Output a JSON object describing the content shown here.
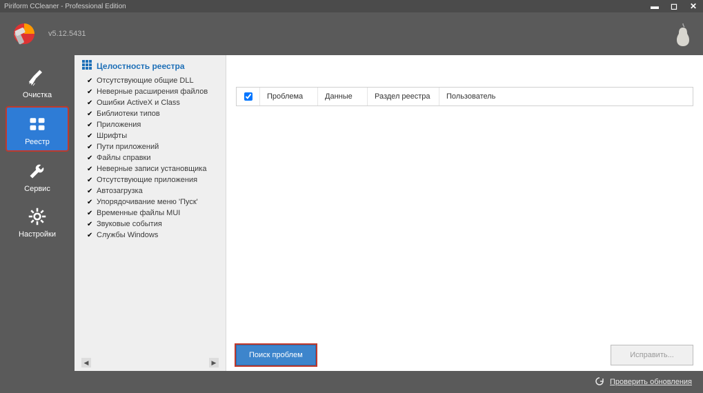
{
  "window": {
    "title": "Piriform CCleaner - Professional Edition"
  },
  "header": {
    "version": "v5.12.5431"
  },
  "sidebar": {
    "items": [
      {
        "label": "Очистка"
      },
      {
        "label": "Реестр"
      },
      {
        "label": "Сервис"
      },
      {
        "label": "Настройки"
      }
    ]
  },
  "registry": {
    "heading": "Целостность реестра",
    "checks": [
      "Отсутствующие общие DLL",
      "Неверные расширения файлов",
      "Ошибки ActiveX и Class",
      "Библиотеки типов",
      "Приложения",
      "Шрифты",
      "Пути приложений",
      "Файлы справки",
      "Неверные записи установщика",
      "Отсутствующие приложения",
      "Автозагрузка",
      "Упорядочивание меню 'Пуск'",
      "Временные файлы MUI",
      "Звуковые события",
      "Службы Windows"
    ]
  },
  "table": {
    "columns": [
      "Проблема",
      "Данные",
      "Раздел реестра",
      "Пользователь"
    ]
  },
  "actions": {
    "scan": "Поиск проблем",
    "fix": "Исправить..."
  },
  "footer": {
    "check_updates": "Проверить обновления"
  }
}
